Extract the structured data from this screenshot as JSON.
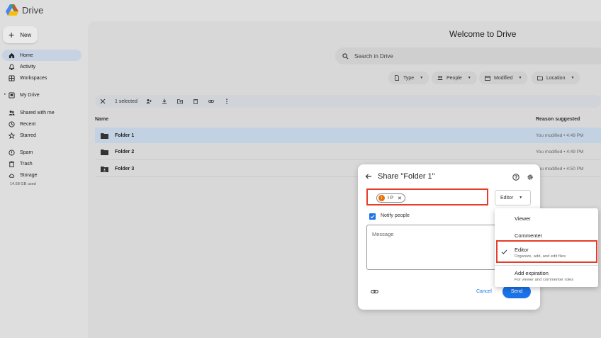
{
  "app": {
    "title": "Drive"
  },
  "sidebar": {
    "new_label": "New",
    "items": [
      {
        "label": "Home",
        "icon": "home-icon"
      },
      {
        "label": "Activity",
        "icon": "bell-icon"
      },
      {
        "label": "Workspaces",
        "icon": "workspaces-icon"
      },
      {
        "label": "My Drive",
        "icon": "my-drive-icon"
      },
      {
        "label": "Shared with me",
        "icon": "shared-icon"
      },
      {
        "label": "Recent",
        "icon": "clock-icon"
      },
      {
        "label": "Starred",
        "icon": "star-icon"
      },
      {
        "label": "Spam",
        "icon": "spam-icon"
      },
      {
        "label": "Trash",
        "icon": "trash-icon"
      },
      {
        "label": "Storage",
        "icon": "cloud-icon"
      }
    ],
    "storage_used": "14.68 GB used"
  },
  "main": {
    "title": "Welcome to Drive",
    "search_placeholder": "Search in Drive",
    "filters": [
      "Type",
      "People",
      "Modified",
      "Location"
    ],
    "selection": {
      "count_label": "1 selected"
    },
    "columns": {
      "name": "Name",
      "reason": "Reason suggested"
    },
    "files": [
      {
        "name": "Folder 1",
        "reason": "You modified • 4:49 PM",
        "selected": true
      },
      {
        "name": "Folder 2",
        "reason": "You modified • 4:49 PM",
        "selected": false
      },
      {
        "name": "Folder 3",
        "reason": "You modified • 4:50 PM",
        "selected": false
      }
    ]
  },
  "share_dialog": {
    "title": "Share \"Folder 1\"",
    "person": {
      "initial": "I",
      "label": "I P"
    },
    "role": "Editor",
    "notify_label": "Notify people",
    "notify_checked": true,
    "message_placeholder": "Message",
    "cancel_label": "Cancel",
    "send_label": "Send"
  },
  "role_menu": {
    "items": [
      {
        "label": "Viewer"
      },
      {
        "label": "Commenter"
      },
      {
        "label": "Editor",
        "sub": "Organize, add, and edit files",
        "checked": true
      },
      {
        "label": "Add expiration",
        "sub": "For viewer and commenter roles"
      }
    ]
  },
  "colors": {
    "accent": "#1a73e8",
    "highlight": "#e53d2a",
    "avatar": "#e8710a"
  }
}
